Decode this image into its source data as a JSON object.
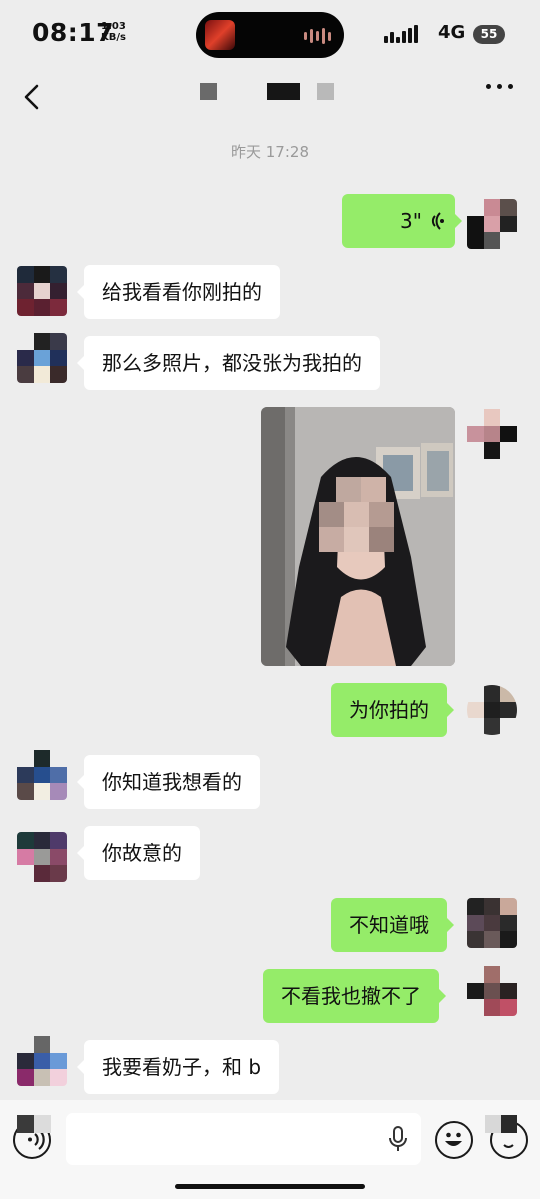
{
  "status_bar": {
    "time": "08:17",
    "net_speed_value": "1.03",
    "net_speed_unit": "KB/s",
    "network": "4G",
    "battery": "55"
  },
  "chat": {
    "timestamp": "昨天 17:28",
    "voice_message": {
      "duration": "3\""
    },
    "messages": [
      {
        "text": "给我看看你刚拍的"
      },
      {
        "text": "那么多照片，都没张为我拍的"
      },
      {
        "text": "为你拍的"
      },
      {
        "text": "你知道我想看的"
      },
      {
        "text": "你故意的"
      },
      {
        "text": "不知道哦"
      },
      {
        "text": "不看我也撤不了"
      },
      {
        "text": "我要看奶子，和 b"
      }
    ]
  },
  "colors": {
    "outgoing_bubble": "#95ec69",
    "incoming_bubble": "#ffffff",
    "background": "#ededed"
  },
  "icons": [
    "back-icon",
    "more-icon",
    "voice-wave-icon",
    "voice-input-icon",
    "microphone-icon",
    "emoji-icon",
    "add-icon"
  ]
}
